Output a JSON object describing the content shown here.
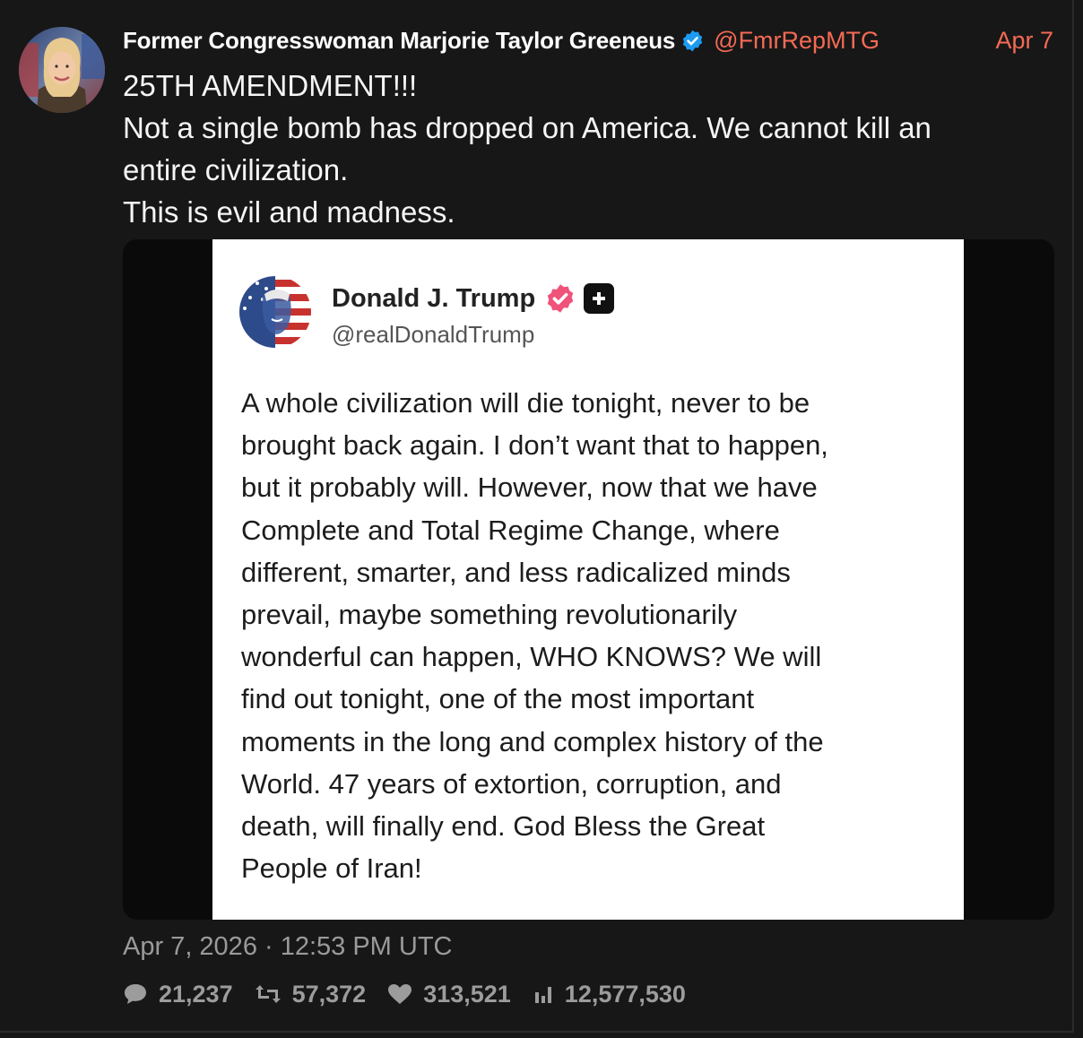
{
  "post": {
    "author_name": "Former Congresswoman Marjorie Taylor Greeneus",
    "author_handle": "@FmrRepMTG",
    "date_short": "Apr 7",
    "text_lines": [
      "25TH AMENDMENT!!!",
      "Not a single bomb has dropped on America. We cannot kill an",
      "entire civilization.",
      "This is evil and madness."
    ],
    "timestamp": "Apr 7, 2026 · 12:53 PM UTC",
    "icons": {
      "avatar": "profile-photo",
      "verified": "verified-badge-icon"
    }
  },
  "embedded": {
    "author_name": "Donald J. Trump",
    "author_handle": "@realDonaldTrump",
    "body_lines": [
      "A whole civilization will die tonight, never to be",
      "brought back again. I don’t want that to happen,",
      "but it probably will. However, now that we have",
      "Complete and Total Regime Change, where",
      "different, smarter, and less radicalized minds",
      "prevail, maybe something revolutionarily",
      "wonderful can happen, WHO KNOWS? We will",
      "find out tonight, one of the most important",
      "moments in the long and complex history of the",
      "World. 47 years of extortion, corruption, and",
      "death, will finally end. God Bless the Great",
      "People of Iran!"
    ],
    "icons": {
      "avatar": "profile-photo",
      "verified": "verified-badge-icon",
      "plus": "plus-icon"
    }
  },
  "stats": {
    "replies": "21,237",
    "reposts": "57,372",
    "likes": "313,521",
    "views": "12,577,530"
  },
  "colors": {
    "background": "#171717",
    "accent": "#f46a55",
    "muted": "#9c9c9c",
    "verified_blue": "#1d9bf0",
    "truth_badge_pink": "#f0527a"
  }
}
